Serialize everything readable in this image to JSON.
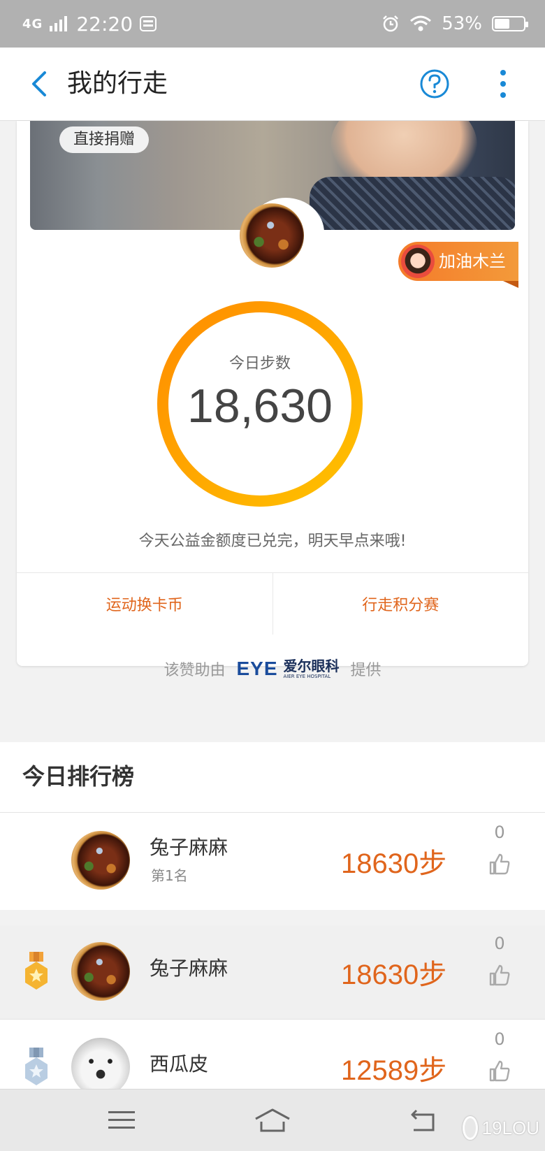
{
  "status_bar": {
    "network": "4G",
    "time": "22:20",
    "battery_percent": "53%",
    "battery_level": 0.53
  },
  "title_bar": {
    "title": "我的行走",
    "back_icon": "chevron-left-icon",
    "help_icon": "question-circle-icon",
    "more_icon": "vertical-dots-icon"
  },
  "card": {
    "donate_chip": "直接捐赠",
    "cheer_tag": "加油木兰",
    "steps_label": "今日步数",
    "steps_value": "18,630",
    "note": "今天公益金额度已兑完，明天早点来哦!",
    "actions": [
      "运动换卡币",
      "行走积分赛"
    ]
  },
  "sponsor": {
    "prefix": "该赞助由",
    "logo_mark": "EYE",
    "logo_cn": "爱尔眼科",
    "logo_en": "AIER EYE HOSPITAL",
    "suffix": "提供"
  },
  "ranking": {
    "title": "今日排行榜",
    "rows": [
      {
        "name": "兔子麻麻",
        "sub": "第1名",
        "steps": "18630步",
        "likes": "0"
      },
      {
        "name": "兔子麻麻",
        "steps": "18630步",
        "likes": "0",
        "medal": "gold-medal-icon"
      },
      {
        "name": "西瓜皮",
        "steps": "12589步",
        "likes": "0",
        "medal": "silver-medal-icon"
      }
    ]
  },
  "nav": {
    "menu_icon": "hamburger-menu-icon",
    "home_icon": "home-icon",
    "back_icon": "back-arrow-icon"
  },
  "watermark": "19LOU",
  "colors": {
    "accent_blue": "#1989d6",
    "accent_orange": "#e0651c",
    "ring_start": "#ff8c00",
    "ring_end": "#ffc200"
  }
}
